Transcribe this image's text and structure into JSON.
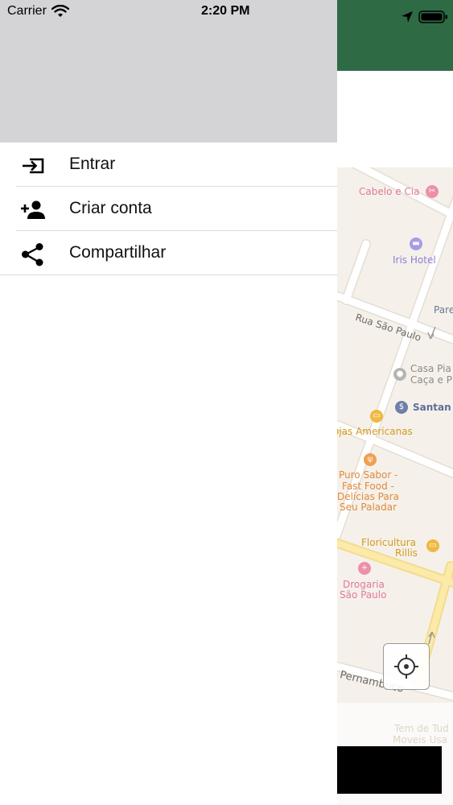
{
  "status_bar": {
    "carrier": "Carrier",
    "time": "2:20 PM"
  },
  "colors": {
    "app_bar": "#2e6b45",
    "drawer_header": "#d4d3d6",
    "map_background": "#f5f1ea"
  },
  "menu": {
    "items": [
      {
        "label": "Entrar",
        "icon": "login-icon"
      },
      {
        "label": "Criar conta",
        "icon": "person-add-icon"
      },
      {
        "label": "Compartilhar",
        "icon": "share-icon"
      }
    ]
  },
  "map": {
    "streets": {
      "sao_paulo": "Rua São Paulo",
      "pernambuco": "Pernambuco"
    },
    "places": {
      "cabelo": "Cabelo e Cia",
      "iris": "Iris Hotel",
      "pare": "Pare",
      "casa_line1": "Casa Pia",
      "casa_line2": "Caça e P",
      "santander": "Santan",
      "lojas": "ojas Americanas",
      "puro_line1": "Puro Sabor -",
      "puro_line2": "Fast Food -",
      "puro_line3": "Delícias Para",
      "puro_line4": "Seu Paladar",
      "flori_line1": "Floricultura",
      "flori_line2": "Rillis",
      "drogaria_line1": "Drogaria",
      "drogaria_line2": "São Paulo",
      "tem_line1": "Tem de Tud",
      "tem_line2": "Moveis Usa"
    }
  }
}
